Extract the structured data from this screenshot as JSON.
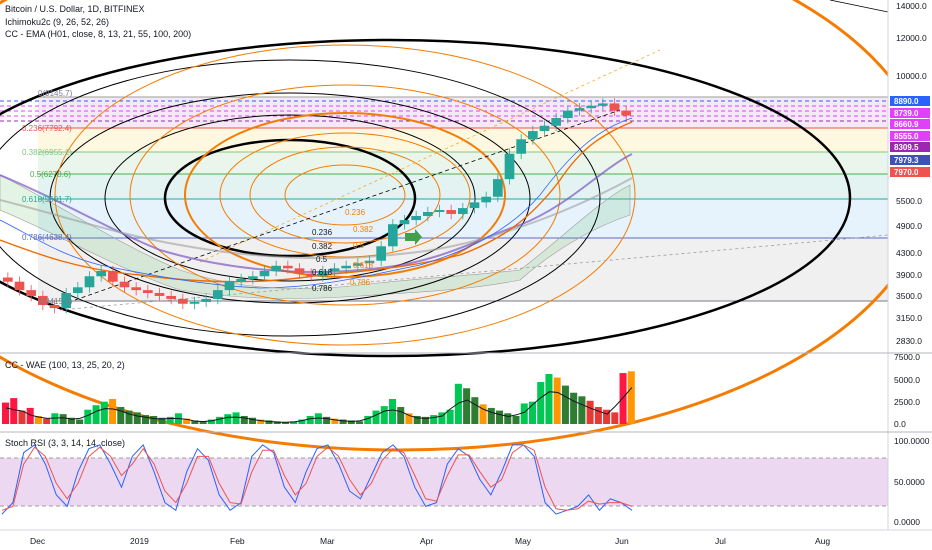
{
  "header": {
    "title": "Bitcoin / U.S. Dollar, 1D, BITFINEX",
    "ichimoku": "Ichimoku2c (9, 26, 52, 26)",
    "ema": "CC - EMA (H01, close, 8, 13, 21, 55, 100, 200)",
    "wae": "CC - WAE (100, 13, 25, 20, 2)",
    "stoch": "Stoch RSI (3, 3, 14, 14, close)"
  },
  "chart_data": [
    {
      "type": "line",
      "name": "price",
      "price_axis_labels": [
        "14000.0",
        "12000.0",
        "10000.0",
        "5500.0",
        "4900.0",
        "4300.0",
        "3900.0",
        "3500.0",
        "3150.0",
        "2830.0"
      ],
      "time_axis_labels": [
        "Dec",
        "2019",
        "Feb",
        "Mar",
        "Apr",
        "May",
        "Jun",
        "Jul",
        "Aug"
      ],
      "price_badges": [
        {
          "text": "8890.0",
          "color": "#2962ff"
        },
        {
          "text": "8739.0",
          "color": "#e040fb"
        },
        {
          "text": "8660.9",
          "color": "#e040fb"
        },
        {
          "text": "8555.0",
          "color": "#e040fb"
        },
        {
          "text": "8309.5",
          "color": "#9c27b0"
        },
        {
          "text": "7979.3",
          "color": "#3f51b5"
        },
        {
          "text": "7970.0",
          "color": "#ef5350"
        }
      ],
      "fib_levels": [
        {
          "label": "0(9145.7)",
          "color": "#7b7b9a"
        },
        {
          "label": "0.236(7792.4)",
          "color": "#ef5350"
        },
        {
          "label": "0.382(6955.1)",
          "color": "#81c784"
        },
        {
          "label": "0.5(6278.6)",
          "color": "#4caf50"
        },
        {
          "label": "0.618(5601.7)",
          "color": "#26a69a"
        },
        {
          "label": "0.786(4638.4)",
          "color": "#5c6bc0"
        },
        {
          "label": "1(3415.4)",
          "color": "#787b86"
        }
      ],
      "circle_labels": [
        "0.236",
        "0.382",
        "0.5",
        "0.618",
        "0.786",
        "0.236",
        "0.382",
        "0.5",
        "0.618",
        "0.786"
      ],
      "close_series": [
        3800,
        3650,
        3550,
        3400,
        3350,
        3600,
        3700,
        3900,
        4000,
        3800,
        3700,
        3650,
        3600,
        3550,
        3500,
        3420,
        3450,
        3500,
        3650,
        3800,
        3850,
        3900,
        4000,
        4100,
        4050,
        3950,
        3900,
        4000,
        4050,
        4100,
        4150,
        4200,
        4500,
        5000,
        5100,
        5200,
        5300,
        5350,
        5250,
        5400,
        5550,
        5700,
        6200,
        7000,
        7500,
        7800,
        8000,
        8300,
        8600,
        8700,
        8800,
        8900,
        8600,
        8400
      ]
    },
    {
      "type": "bar",
      "name": "CC - WAE",
      "y_axis_labels": [
        "7500.0",
        "5000.0",
        "2500.0",
        "0.0"
      ],
      "values": [
        2400,
        2900,
        1500,
        1800,
        900,
        600,
        1200,
        1100,
        700,
        500,
        1600,
        2100,
        2500,
        2800,
        1900,
        1500,
        1300,
        1000,
        900,
        700,
        800,
        1200,
        600,
        400,
        300,
        500,
        800,
        1100,
        1300,
        900,
        700,
        500,
        400,
        300,
        200,
        300,
        500,
        900,
        1200,
        800,
        600,
        500,
        400,
        300,
        900,
        1500,
        2000,
        2800,
        1900,
        1200,
        900,
        800,
        1000,
        1300,
        1600,
        4500,
        4000,
        3000,
        2200,
        1800,
        1500,
        1200,
        900,
        2300,
        2500,
        4700,
        5600,
        5200,
        4300,
        3500,
        3100,
        2600,
        1900,
        1600,
        1300,
        5700,
        5900
      ]
    },
    {
      "type": "line",
      "name": "Stoch RSI",
      "y_axis_labels": [
        "100.0000",
        "50.0000",
        "0.0000"
      ],
      "k_values": [
        5,
        20,
        85,
        95,
        70,
        30,
        15,
        60,
        90,
        95,
        70,
        40,
        80,
        95,
        60,
        20,
        10,
        60,
        90,
        75,
        30,
        10,
        20,
        80,
        95,
        85,
        40,
        20,
        60,
        90,
        95,
        70,
        35,
        25,
        55,
        85,
        95,
        80,
        40,
        15,
        20,
        70,
        90,
        80,
        50,
        30,
        60,
        95,
        95,
        80,
        20,
        5,
        10,
        15,
        30,
        10,
        25,
        20,
        10
      ],
      "d_values": [
        10,
        15,
        70,
        92,
        80,
        45,
        25,
        45,
        80,
        92,
        80,
        55,
        70,
        90,
        70,
        35,
        20,
        45,
        80,
        80,
        45,
        20,
        18,
        60,
        88,
        88,
        55,
        30,
        45,
        80,
        92,
        80,
        50,
        30,
        45,
        75,
        90,
        85,
        55,
        25,
        22,
        55,
        82,
        82,
        60,
        40,
        50,
        85,
        95,
        88,
        40,
        12,
        10,
        12,
        22,
        18,
        20,
        20,
        15
      ]
    }
  ]
}
